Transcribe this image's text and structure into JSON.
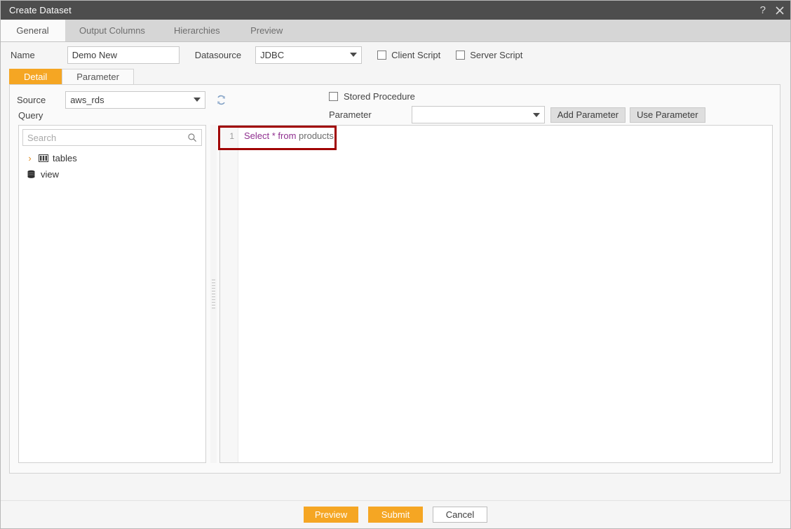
{
  "window": {
    "title": "Create Dataset",
    "help_label": "?",
    "close_label": "✕"
  },
  "tabs": [
    {
      "label": "General",
      "active": true
    },
    {
      "label": "Output Columns",
      "active": false
    },
    {
      "label": "Hierarchies",
      "active": false
    },
    {
      "label": "Preview",
      "active": false
    }
  ],
  "general": {
    "name_label": "Name",
    "name_value": "Demo New",
    "name_placeholder": "",
    "datasource_label": "Datasource",
    "datasource_value": "JDBC",
    "client_script_label": "Client Script",
    "client_script_checked": false,
    "server_script_label": "Server Script",
    "server_script_checked": false
  },
  "subtabs": [
    {
      "label": "Detail",
      "active": true
    },
    {
      "label": "Parameter",
      "active": false
    }
  ],
  "detail": {
    "source_label": "Source",
    "source_value": "aws_rds",
    "refresh_icon": "refresh-icon",
    "stored_procedure_label": "Stored Procedure",
    "stored_procedure_checked": false,
    "query_label": "Query",
    "parameter_label": "Parameter",
    "parameter_value": "",
    "add_parameter_label": "Add Parameter",
    "use_parameter_label": "Use Parameter"
  },
  "tree": {
    "search_placeholder": "Search",
    "search_value": "",
    "search_icon": "search-icon",
    "nodes": [
      {
        "label": "tables",
        "icon": "table-icon",
        "expandable": true,
        "chevron": "›"
      },
      {
        "label": "view",
        "icon": "database-icon",
        "expandable": false,
        "chevron": ""
      }
    ]
  },
  "editor": {
    "line_numbers": [
      "1"
    ],
    "sql_keyword_part": "Select * from ",
    "sql_identifier_part": "products",
    "full_sql": "Select * from products"
  },
  "footer": {
    "preview_label": "Preview",
    "submit_label": "Submit",
    "cancel_label": "Cancel"
  },
  "colors": {
    "accent": "#f5a623",
    "titlebar": "#4d4d4d",
    "tabstrip": "#d6d6d6",
    "annotation": "#a00000",
    "sql_keyword": "#8f2f8f",
    "sql_identifier": "#6b6b6b"
  }
}
